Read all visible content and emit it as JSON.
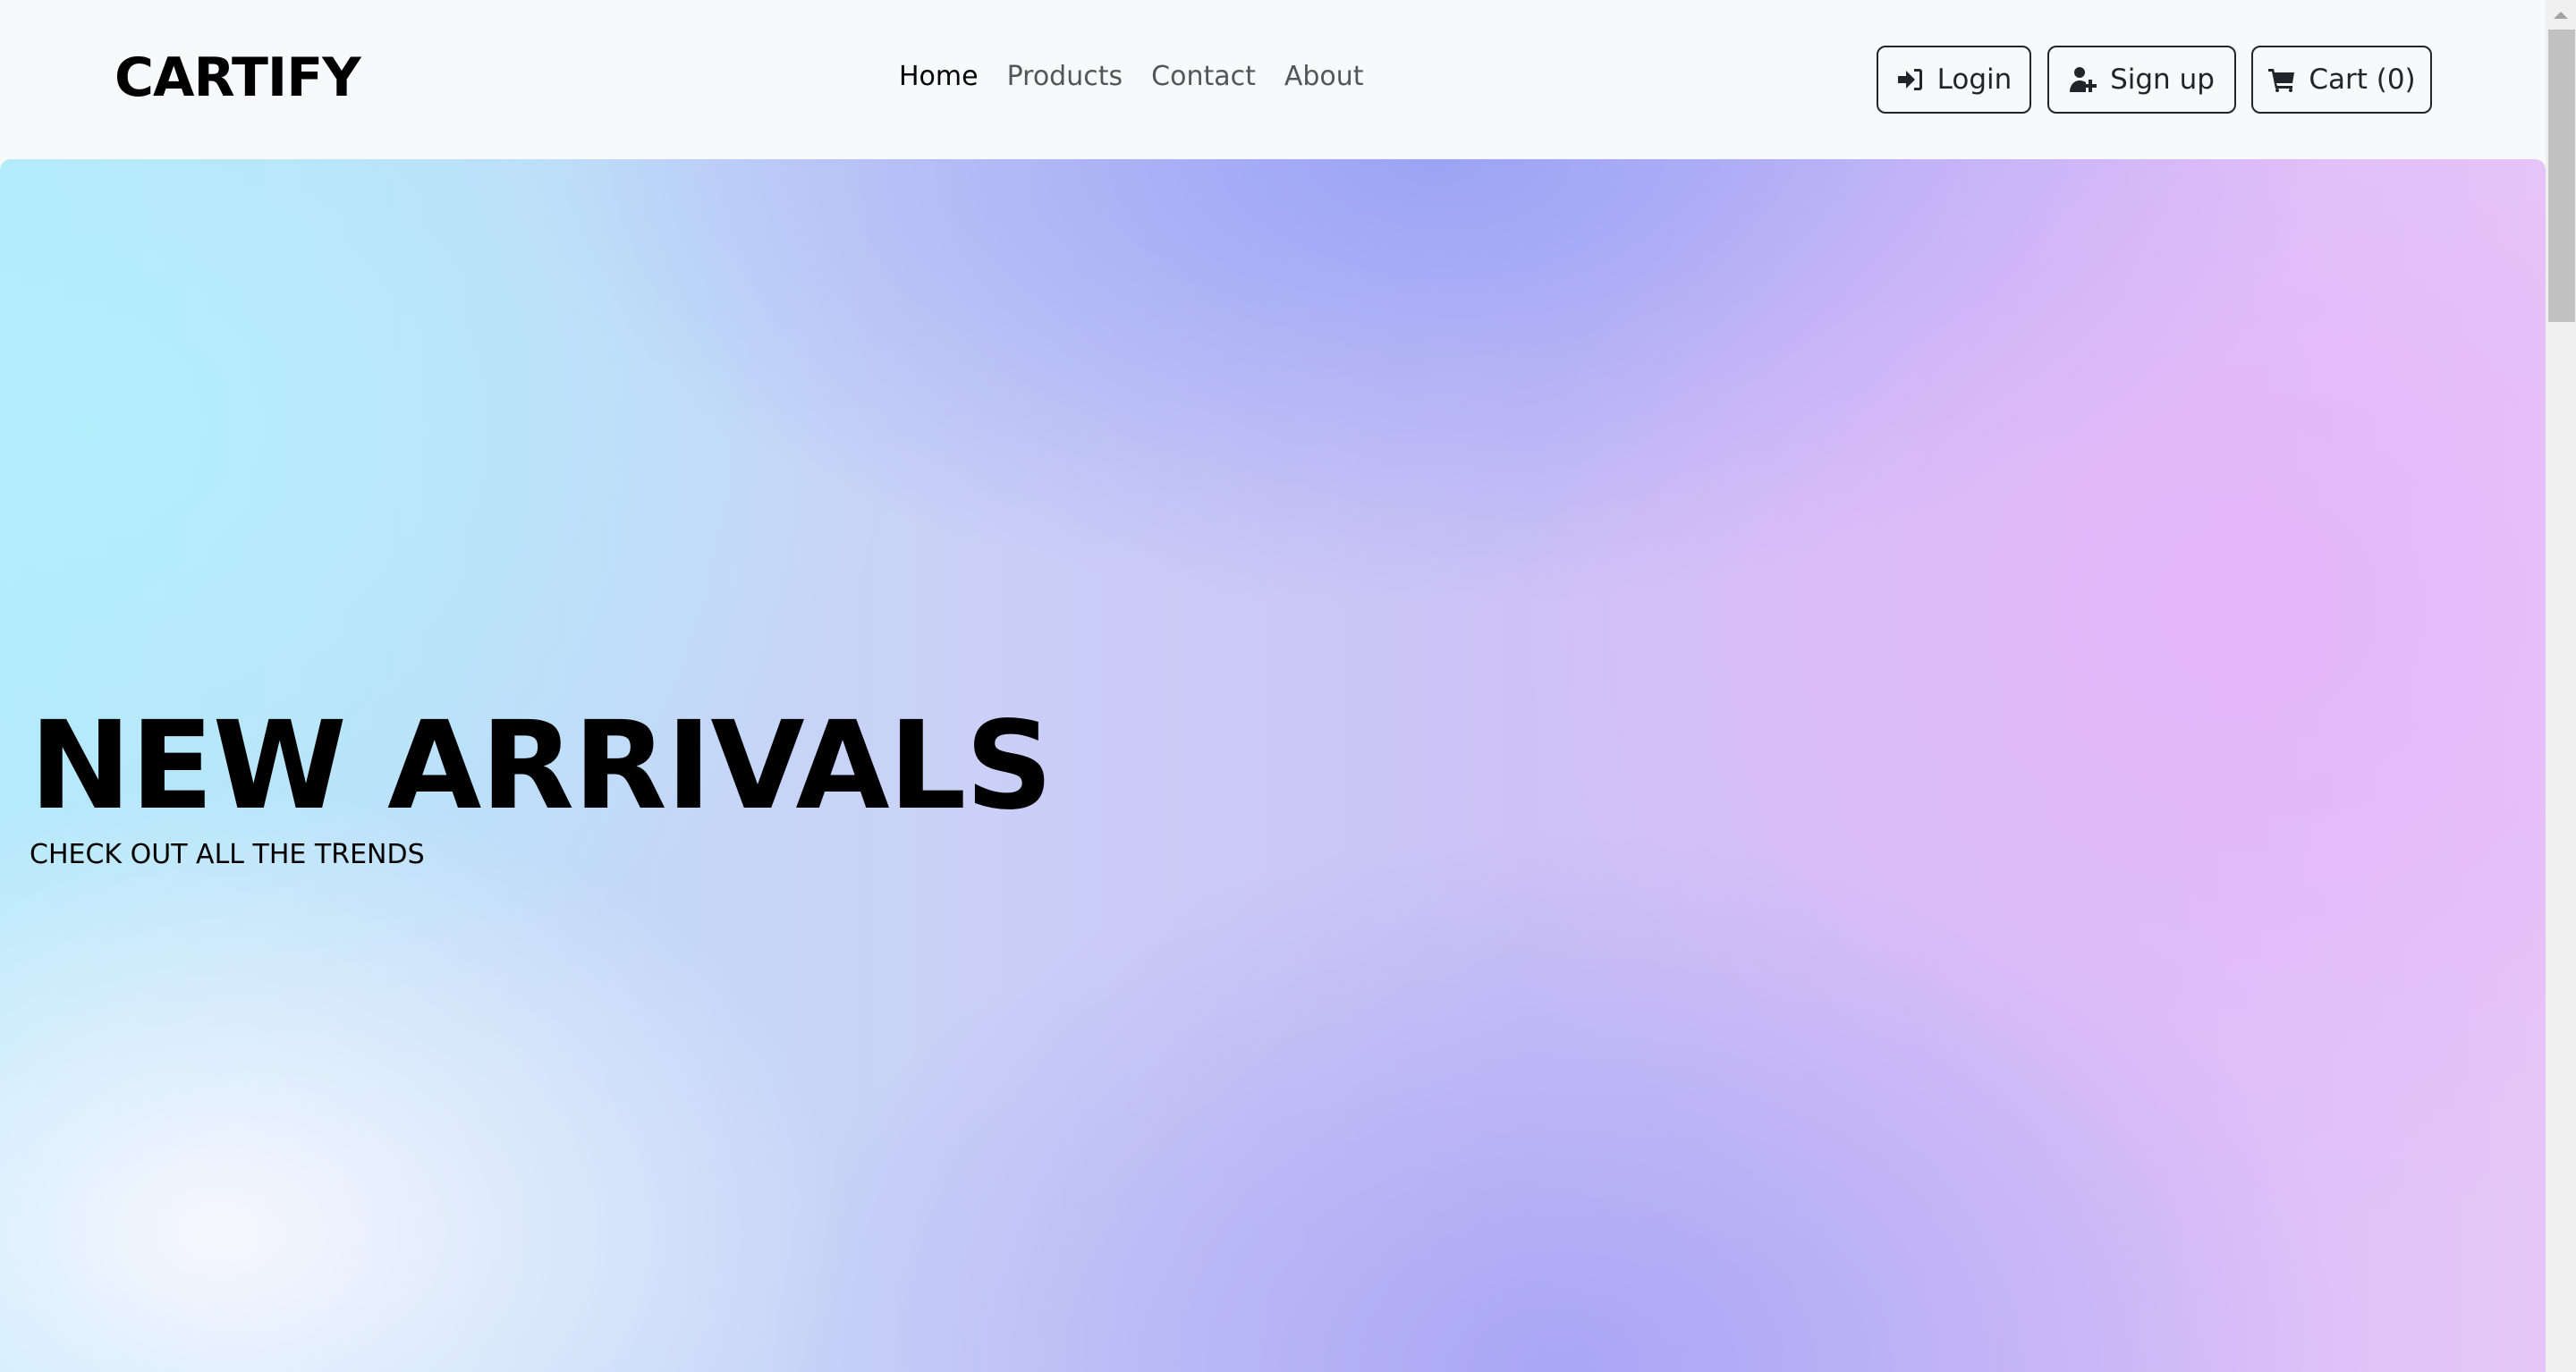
{
  "brand": "CARTIFY",
  "nav": {
    "items": [
      {
        "label": "Home",
        "active": true
      },
      {
        "label": "Products",
        "active": false
      },
      {
        "label": "Contact",
        "active": false
      },
      {
        "label": "About",
        "active": false
      }
    ]
  },
  "actions": {
    "login": {
      "label": "Login",
      "icon": "sign-in-icon"
    },
    "signup": {
      "label": "Sign up",
      "icon": "user-plus-icon"
    },
    "cart": {
      "label": "Cart (0)",
      "icon": "cart-icon"
    }
  },
  "hero": {
    "title": "NEW ARRIVALS",
    "subtitle": "CHECK OUT ALL THE TRENDS"
  },
  "colors": {
    "navbar_bg": "#f8f9fa",
    "button_border": "#212529",
    "nav_active": "#000000",
    "nav_inactive": "#555555"
  }
}
